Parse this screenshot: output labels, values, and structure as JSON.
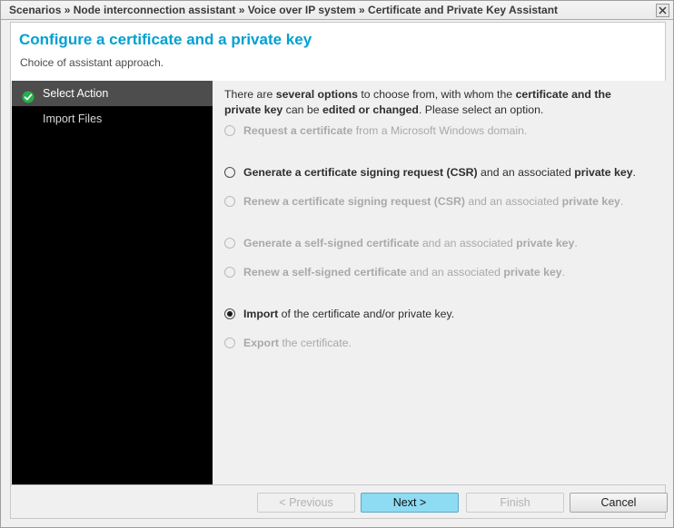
{
  "window": {
    "breadcrumb": "Scenarios » Node interconnection assistant » Voice over IP system » Certificate and Private Key Assistant",
    "close_icon": "close-icon"
  },
  "header": {
    "title": "Configure a certificate and a private key",
    "subtitle": "Choice of assistant approach.",
    "title_color": "#00a0d2"
  },
  "sidebar": {
    "items": [
      {
        "label": "Select Action",
        "active": true,
        "icon": "check-circle-icon"
      },
      {
        "label": "Import Files",
        "active": false,
        "icon": ""
      }
    ]
  },
  "content": {
    "intro": {
      "part1": "There are ",
      "bold1": "several options",
      "part2": " to choose from, with whom the ",
      "bold2": "certificate and the private key",
      "part3": " can be ",
      "bold3": "edited or changed",
      "part4": ". Please select an option."
    },
    "options": [
      {
        "id": "request-certificate",
        "bold": "Request a certificate",
        "rest": " from a Microsoft Windows domain.",
        "tail_bold": "",
        "tail_rest": "",
        "selected": false,
        "disabled": true
      },
      {
        "id": "generate-csr",
        "bold": "Generate a certificate signing request (CSR)",
        "rest": " and an associated ",
        "tail_bold": "private key",
        "tail_rest": ".",
        "selected": false,
        "disabled": false
      },
      {
        "id": "renew-csr",
        "bold": "Renew a certificate signing request (CSR)",
        "rest": " and an associated ",
        "tail_bold": "private key",
        "tail_rest": ".",
        "selected": false,
        "disabled": true
      },
      {
        "id": "generate-self-signed",
        "bold": "Generate a self-signed certificate",
        "rest": " and an associated ",
        "tail_bold": "private key",
        "tail_rest": ".",
        "selected": false,
        "disabled": true
      },
      {
        "id": "renew-self-signed",
        "bold": "Renew a self-signed certificate",
        "rest": " and an associated ",
        "tail_bold": "private key",
        "tail_rest": ".",
        "selected": false,
        "disabled": true
      },
      {
        "id": "import",
        "bold": "Import",
        "rest": " of the certificate and/or private key.",
        "tail_bold": "",
        "tail_rest": "",
        "selected": true,
        "disabled": false
      },
      {
        "id": "export",
        "bold": "Export",
        "rest": " the certificate.",
        "tail_bold": "",
        "tail_rest": "",
        "selected": false,
        "disabled": true
      }
    ]
  },
  "footer": {
    "previous_label": "< Previous",
    "next_label": "Next >",
    "finish_label": "Finish",
    "cancel_label": "Cancel",
    "previous_disabled": true,
    "next_primary": true,
    "finish_disabled": true,
    "cancel_disabled": false,
    "accent_color": "#8ddcf4"
  }
}
